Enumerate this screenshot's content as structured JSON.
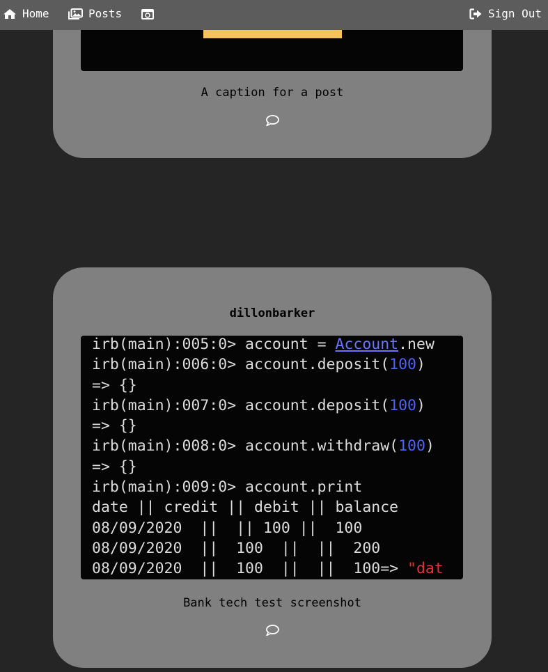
{
  "nav": {
    "home_label": "Home",
    "posts_label": "Posts",
    "signout_label": "Sign Out",
    "icons": {
      "home": "home-icon",
      "posts": "images-icon",
      "camera": "camera-icon",
      "signout": "sign-out-icon"
    }
  },
  "posts": [
    {
      "caption": "A caption for a post",
      "image_accent": "#f6c25a"
    },
    {
      "username": "dillonbarker",
      "caption": "Bank tech test screenshot",
      "terminal": {
        "lines": [
          [
            "irb(main):005:0> account = ",
            "Account",
            ".new"
          ],
          [
            "irb(main):006:0> account.deposit(",
            "100",
            ")"
          ],
          [
            "=> {}"
          ],
          [
            "irb(main):007:0> account.deposit(",
            "100",
            ")"
          ],
          [
            "=> {}"
          ],
          [
            "irb(main):008:0> account.withdraw(",
            "100",
            ")"
          ],
          [
            "=> {}"
          ],
          [
            "irb(main):009:0> account.print"
          ],
          [
            "date || credit || debit || balance"
          ],
          [
            "08/09/2020  ||  || 100 ||  100"
          ],
          [
            "08/09/2020  ||  100  ||  ||  200"
          ],
          [
            "08/09/2020  ||  100  ||  ||  100=> ",
            "\"dat"
          ]
        ]
      }
    }
  ],
  "colors": {
    "background": "#252525",
    "navbar": "#5c5c5c",
    "card": "#808080"
  }
}
